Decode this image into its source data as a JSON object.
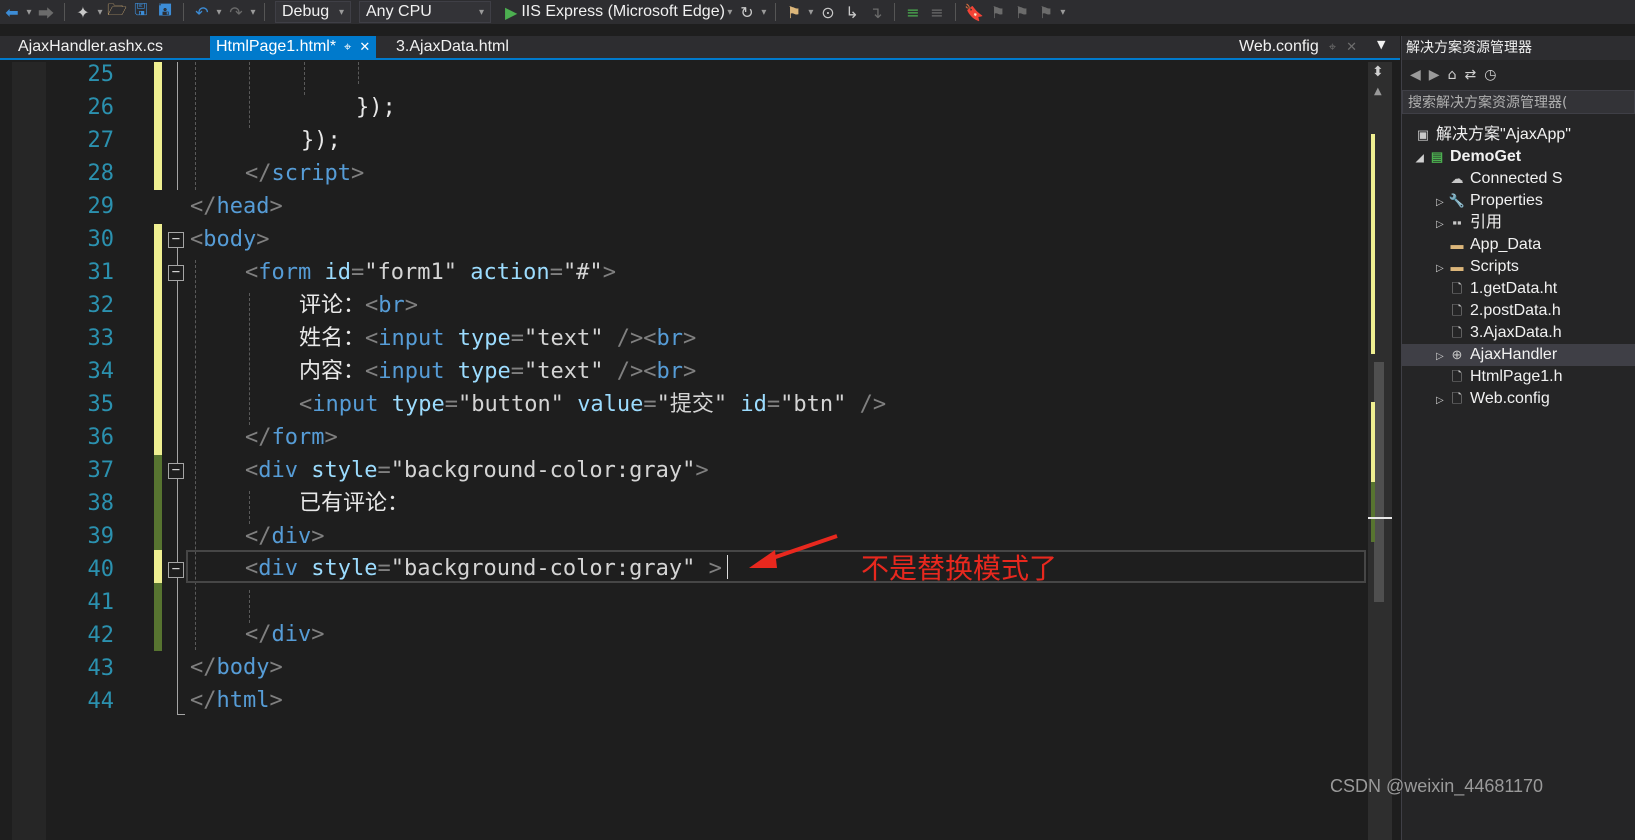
{
  "toolbar": {
    "config": "Debug",
    "platform": "Any CPU",
    "run_target": "IIS Express (Microsoft Edge)"
  },
  "tabs": [
    {
      "label": "AjaxHandler.ashx.cs",
      "active": false
    },
    {
      "label": "HtmlPage1.html*",
      "active": true
    },
    {
      "label": "3.AjaxData.html",
      "active": false
    },
    {
      "label": "Web.config",
      "active": false
    }
  ],
  "editor": {
    "line_numbers": [
      "25",
      "26",
      "27",
      "28",
      "29",
      "30",
      "31",
      "32",
      "33",
      "34",
      "35",
      "36",
      "37",
      "38",
      "39",
      "40",
      "41",
      "42",
      "43",
      "44"
    ],
    "lines": {
      "l26": [
        "});"
      ],
      "l27": [
        "});"
      ],
      "l28": [
        "</",
        "script",
        ">"
      ],
      "l29": [
        "</",
        "head",
        ">"
      ],
      "l30": [
        "<",
        "body",
        ">"
      ],
      "l31": [
        "<",
        "form",
        " ",
        "id",
        "=",
        "\"form1\"",
        " ",
        "action",
        "=",
        "\"#\"",
        ">"
      ],
      "l32": [
        "评论：",
        "<",
        "br",
        ">"
      ],
      "l33": [
        "姓名：",
        "<",
        "input",
        " ",
        "type",
        "=",
        "\"text\"",
        " />",
        "<",
        "br",
        ">"
      ],
      "l34": [
        "内容：",
        "<",
        "input",
        " ",
        "type",
        "=",
        "\"text\"",
        " />",
        "<",
        "br",
        ">"
      ],
      "l35": [
        "<",
        "input",
        " ",
        "type",
        "=",
        "\"button\"",
        " ",
        "value",
        "=",
        "\"提交\"",
        " ",
        "id",
        "=",
        "\"btn\"",
        " />"
      ],
      "l36": [
        "</",
        "form",
        ">"
      ],
      "l37": [
        "<",
        "div",
        " ",
        "style",
        "=",
        "\"background-color:gray\"",
        ">"
      ],
      "l38": [
        "已有评论："
      ],
      "l39": [
        "</",
        "div",
        ">"
      ],
      "l40": [
        "<",
        "div",
        " ",
        "style",
        "=",
        "\"background-color:gray\"",
        " ",
        ">"
      ],
      "l42": [
        "</",
        "div",
        ">"
      ],
      "l43": [
        "</",
        "body",
        ">"
      ],
      "l44": [
        "</",
        "html",
        ">"
      ]
    },
    "annotation": "不是替换模式了"
  },
  "solution_explorer": {
    "title": "解决方案资源管理器",
    "search_placeholder": "搜索解决方案资源管理器(",
    "items": [
      {
        "label": "解决方案\"AjaxApp\""
      },
      {
        "label": "DemoGet"
      },
      {
        "label": "Connected S"
      },
      {
        "label": "Properties"
      },
      {
        "label": "引用"
      },
      {
        "label": "App_Data"
      },
      {
        "label": "Scripts"
      },
      {
        "label": "1.getData.ht"
      },
      {
        "label": "2.postData.h"
      },
      {
        "label": "3.AjaxData.h"
      },
      {
        "label": "AjaxHandler"
      },
      {
        "label": "HtmlPage1.h"
      },
      {
        "label": "Web.config"
      }
    ]
  },
  "watermark": "CSDN @weixin_44681170",
  "colors": {
    "accent": "#007acc",
    "tag": "#569cd6",
    "attribute": "#9cdcfe",
    "line_number": "#2b91af",
    "annotation": "#e8281e"
  }
}
